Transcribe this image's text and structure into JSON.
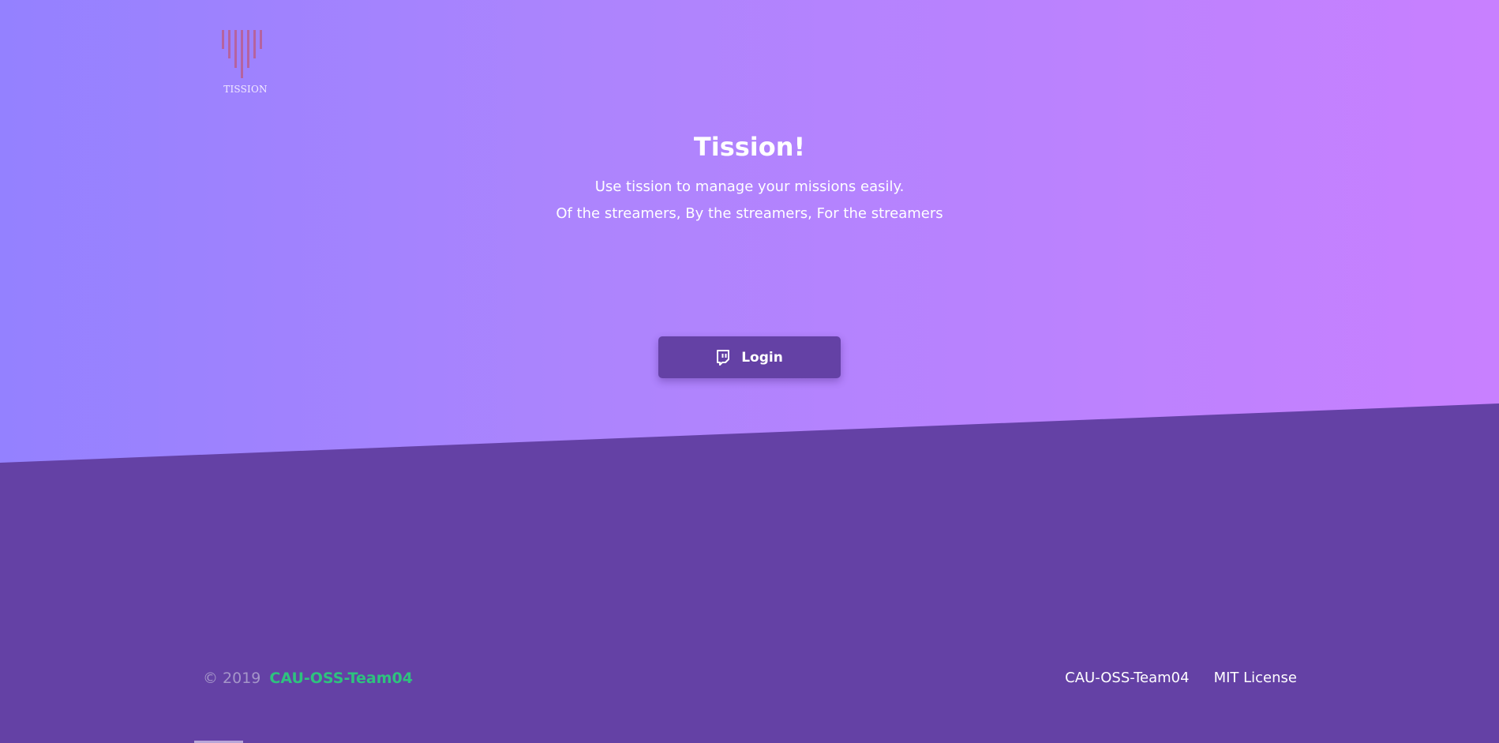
{
  "brand": {
    "logo_text": "TISSION",
    "logo_icon": "tission-logo-icon"
  },
  "hero": {
    "title": "Tission!",
    "subtitle_line1": "Use tission to manage your missions easily.",
    "subtitle_line2": "Of the streamers, By the streamers, For the streamers"
  },
  "login_button": {
    "label": "Login",
    "icon": "twitch-icon"
  },
  "footer": {
    "copyright": "© 2019",
    "team_link": "CAU-OSS-Team04",
    "links": [
      "CAU-OSS-Team04",
      "MIT License"
    ]
  },
  "colors": {
    "gradient_start": "#9481ff",
    "gradient_end": "#c880ff",
    "primary_purple": "#6441a5",
    "team_link_green": "#2ec27e"
  }
}
